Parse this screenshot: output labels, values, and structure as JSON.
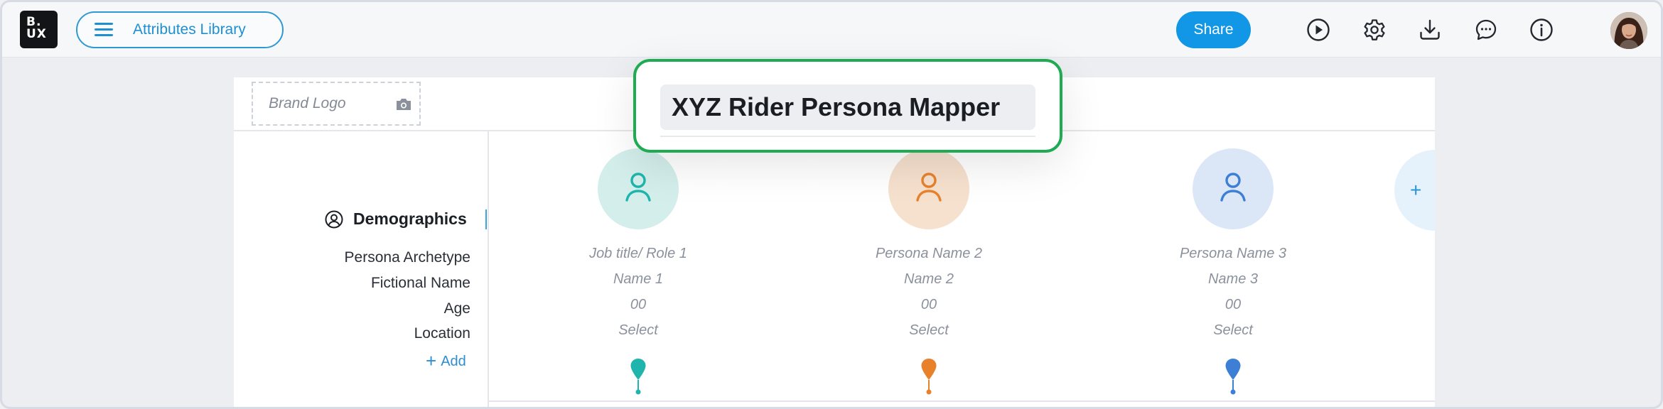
{
  "topbar": {
    "logo_line1": "B.",
    "logo_line2": "UX",
    "library_button": "Attributes Library",
    "share_button": "Share",
    "icons": [
      "play-icon",
      "settings-icon",
      "download-icon",
      "comment-icon",
      "info-icon"
    ]
  },
  "title_editor": {
    "value": "XYZ Rider Persona Mapper"
  },
  "brand_logo": {
    "label": "Brand Logo",
    "icon": "camera-icon"
  },
  "section": {
    "title": "Demographics",
    "icon": "user-circle-icon"
  },
  "attributes": [
    "Persona Archetype",
    "Fictional Name",
    "Age",
    "Location"
  ],
  "add_attribute": "Add",
  "personas": [
    {
      "role": "Job title/ Role 1",
      "name": "Name 1",
      "age": "00",
      "location": "Select",
      "color": "#1fb5ac",
      "bg": "#d3eeeb"
    },
    {
      "role": "Persona Name 2",
      "name": "Name 2",
      "age": "00",
      "location": "Select",
      "color": "#e8822a",
      "bg": "#f6e0ce"
    },
    {
      "role": "Persona Name 3",
      "name": "Name 3",
      "age": "00",
      "location": "Select",
      "color": "#3e7fd6",
      "bg": "#dbe7f7"
    }
  ],
  "add_persona_icon": "+"
}
